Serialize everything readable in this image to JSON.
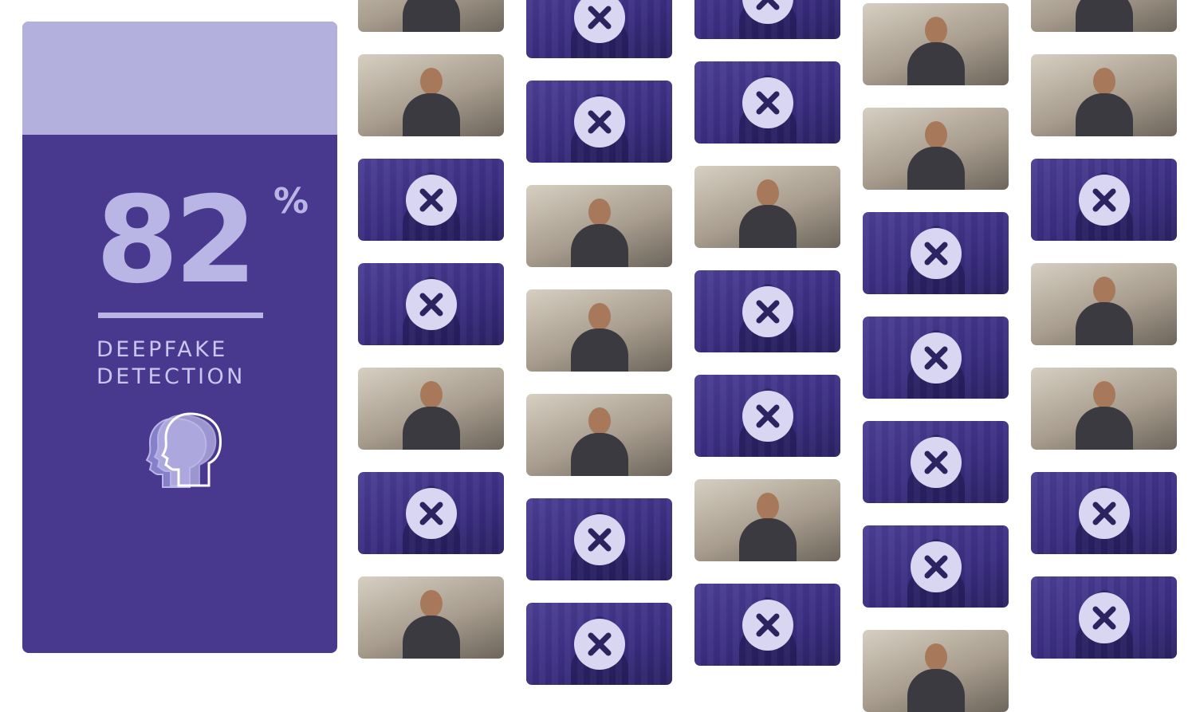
{
  "stat": {
    "value": "82",
    "unit": "%",
    "line1": "DEEPFAKE",
    "line2": "DETECTION",
    "icon": "heads-icon"
  },
  "colors": {
    "panel": "#48388e",
    "panel_top": "#b3b0dd",
    "stat_text": "#b9b6e6",
    "fake_tile": "#3f3288",
    "x_badge": "#d9d6f1",
    "x_mark": "#2b2460"
  },
  "tile_icon": "close-icon",
  "columns": [
    [
      "real",
      "real",
      "fake",
      "fake",
      "real",
      "fake",
      "real"
    ],
    [
      "fake",
      "fake",
      "real",
      "real",
      "real",
      "fake",
      "fake"
    ],
    [
      "fake",
      "fake",
      "real",
      "fake",
      "fake",
      "real",
      "fake"
    ],
    [
      "real",
      "real",
      "fake",
      "fake",
      "fake",
      "fake",
      "real"
    ],
    [
      "real",
      "real",
      "fake",
      "real",
      "real",
      "fake",
      "fake"
    ]
  ]
}
